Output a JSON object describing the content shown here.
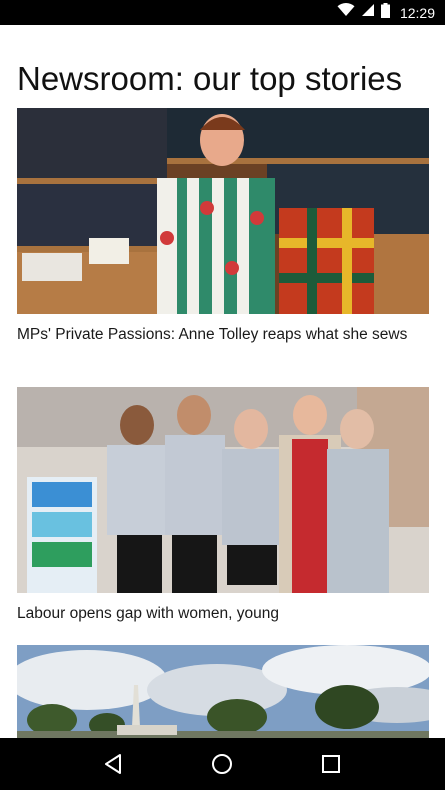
{
  "status_bar": {
    "time": "12:29",
    "icons": [
      "wifi-icon",
      "cell-signal-icon",
      "battery-icon"
    ]
  },
  "page": {
    "title": "Newsroom: our top stories"
  },
  "stories": [
    {
      "title": "MPs' Private Passions: Anne Tolley reaps what she sews",
      "image": "photo of woman holding colourful garments in a bookshelf-lined room"
    },
    {
      "title": "Labour opens gap with women, young",
      "image": "photo of five smiling women in a pharmacy"
    },
    {
      "title": "",
      "image": "photo of a memorial obelisk under a cloudy sky"
    }
  ],
  "nav_bar": {
    "icons": [
      "back-icon",
      "home-icon",
      "recents-icon"
    ]
  },
  "colors": {
    "status_bar_bg": "#000000",
    "nav_bar_bg": "#000000",
    "text": "#111111",
    "background": "#ffffff"
  }
}
